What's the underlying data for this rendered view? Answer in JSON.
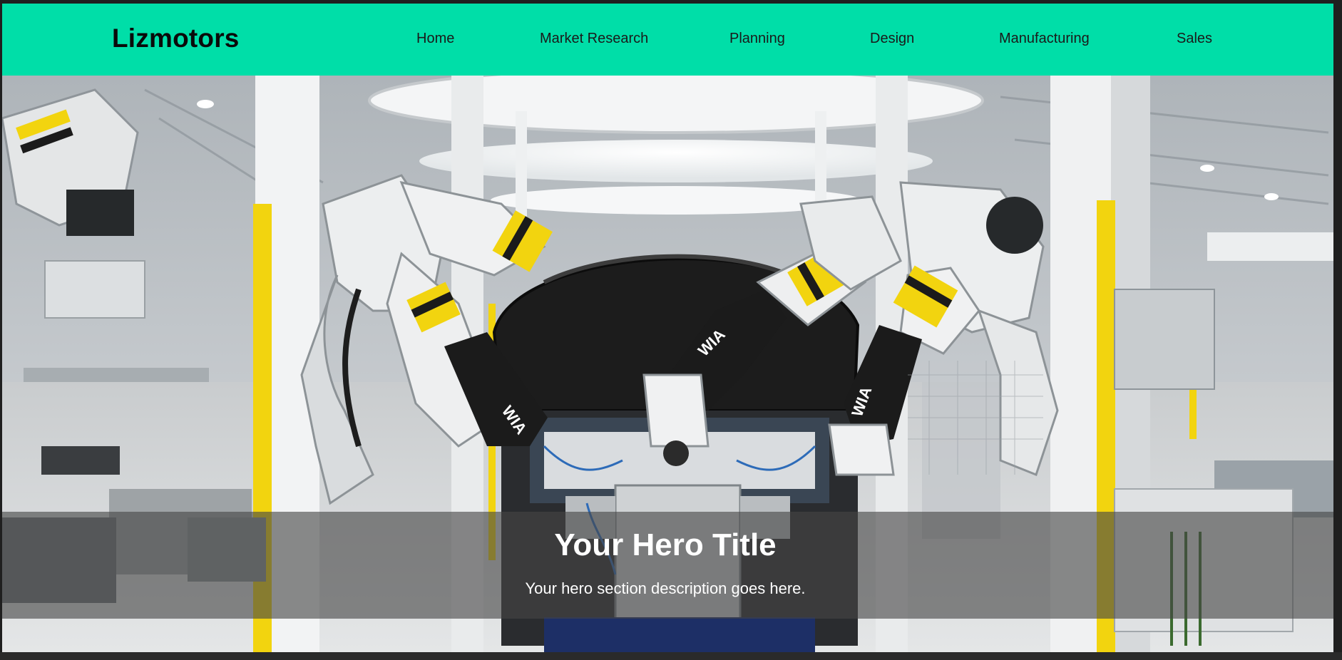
{
  "brand": {
    "name": "Lizmotors"
  },
  "nav": {
    "items": [
      {
        "label": "Home"
      },
      {
        "label": "Market Research"
      },
      {
        "label": "Planning"
      },
      {
        "label": "Design"
      },
      {
        "label": "Manufacturing"
      },
      {
        "label": "Sales"
      }
    ]
  },
  "hero": {
    "title": "Your Hero Title",
    "description": "Your hero section description goes here.",
    "image": "robotic-car-assembly-line-photo",
    "robot_brand_text": "WIA"
  },
  "colors": {
    "navbar_bg": "#00dea8",
    "brand_text": "#0a0a0a",
    "nav_text": "#1a1a1a",
    "hero_overlay": "rgba(70,70,70,0.62)",
    "hero_text": "#ffffff",
    "robot_yellow": "#f2d40f",
    "robot_black": "#1b1b1b"
  }
}
